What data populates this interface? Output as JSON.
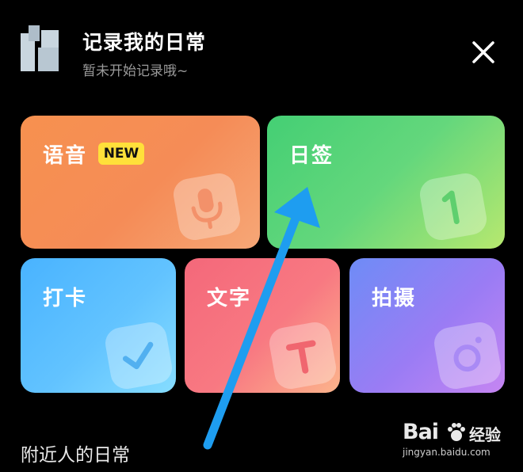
{
  "header": {
    "title": "记录我的日常",
    "subtitle": "暂未开始记录哦~"
  },
  "cards": {
    "voice": {
      "label": "语音",
      "badge": "NEW",
      "icon": "microphone-icon"
    },
    "sign": {
      "label": "日签",
      "icon": "day-number-icon",
      "icon_text": "1"
    },
    "checkin": {
      "label": "打卡",
      "icon": "checkmark-icon"
    },
    "text": {
      "label": "文字",
      "icon": "text-t-icon",
      "icon_text": "T"
    },
    "photo": {
      "label": "拍摄",
      "icon": "camera-icon"
    }
  },
  "section": {
    "nearby_title": "附近人的日常"
  },
  "watermark": {
    "brand": "Bai",
    "brand_cn": "经验",
    "url": "jingyan.baidu.com"
  },
  "colors": {
    "background": "#000000",
    "voice": "#f7914f",
    "sign": "#4fd277",
    "checkin": "#55baff",
    "text": "#f66e7d",
    "photo": "#8c84f5",
    "badge": "#ffe03a",
    "arrow": "#1e9df0"
  }
}
